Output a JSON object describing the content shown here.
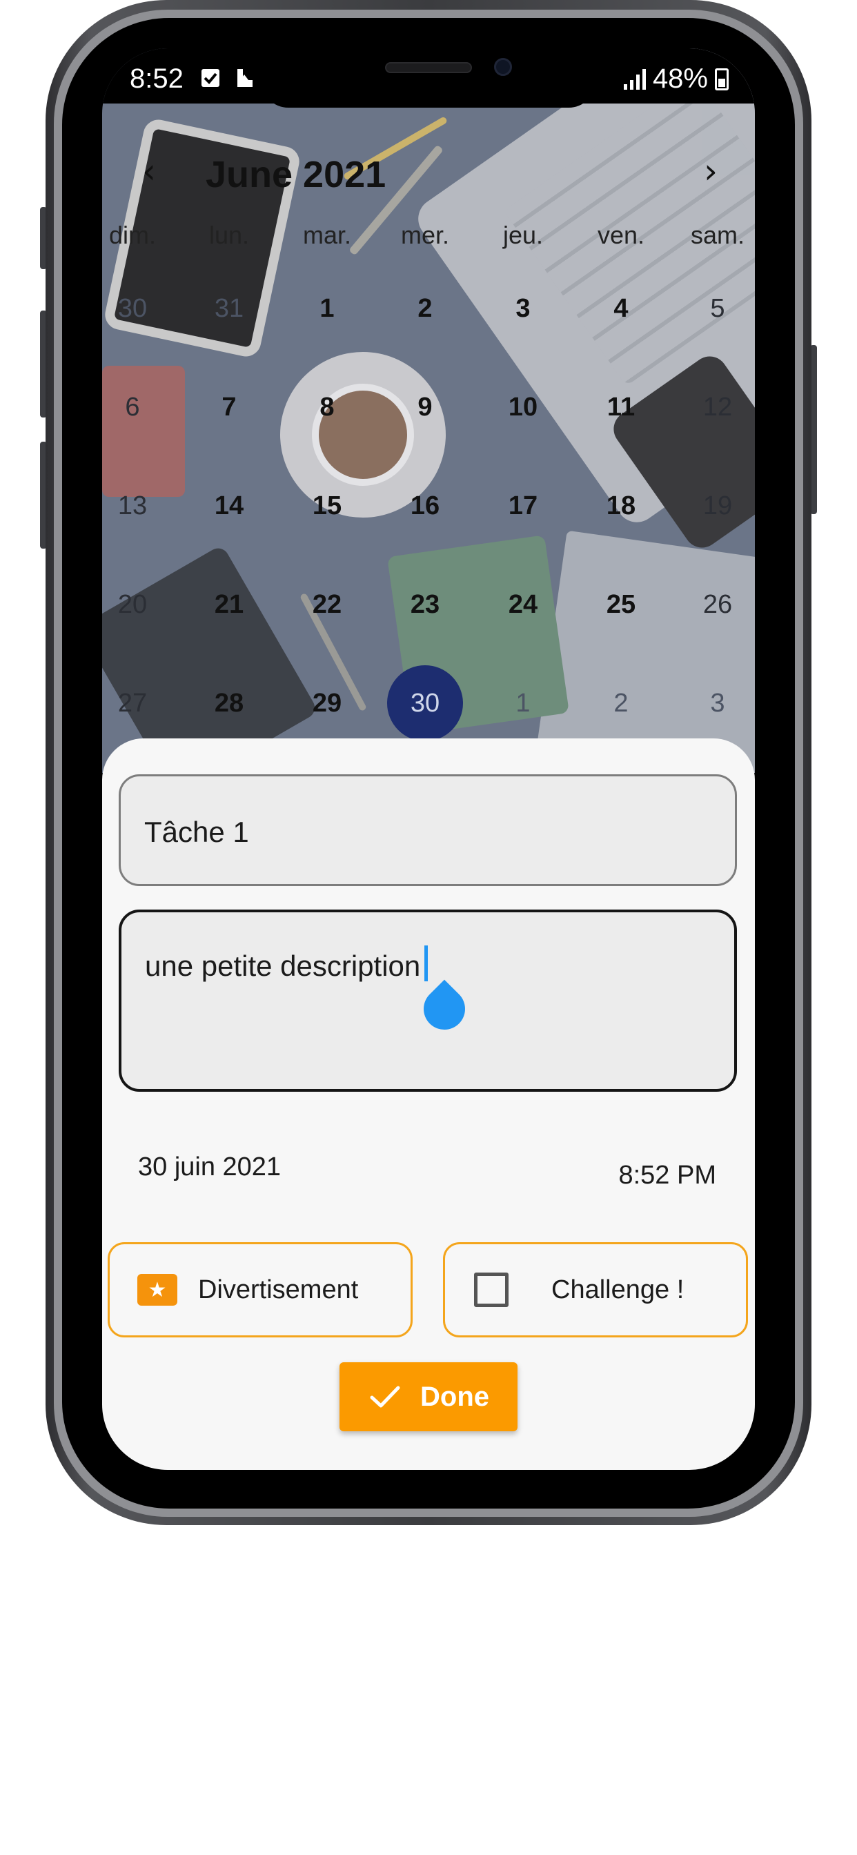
{
  "status_bar": {
    "time": "8:52",
    "battery": "48%",
    "icons": [
      "checkbox-notification-icon",
      "image-notification-icon",
      "signal-icon",
      "battery-charging-icon"
    ]
  },
  "calendar": {
    "title": "June 2021",
    "prev_icon": "chevron-left-icon",
    "next_icon": "chevron-right-icon",
    "weekdays": [
      "dim.",
      "lun.",
      "mar.",
      "mer.",
      "jeu.",
      "ven.",
      "sam."
    ],
    "weeks": [
      [
        "30",
        "31",
        "1",
        "2",
        "3",
        "4",
        "5"
      ],
      [
        "6",
        "7",
        "8",
        "9",
        "10",
        "11",
        "12"
      ],
      [
        "13",
        "14",
        "15",
        "16",
        "17",
        "18",
        "19"
      ],
      [
        "20",
        "21",
        "22",
        "23",
        "24",
        "25",
        "26"
      ],
      [
        "27",
        "28",
        "29",
        "30",
        "1",
        "2",
        "3"
      ]
    ],
    "selected_day": "30"
  },
  "form": {
    "title_value": "Tâche 1",
    "description_value": "une petite description",
    "date": "30 juin 2021",
    "time": "8:52 PM",
    "category_label": "Divertisement",
    "category_icon": "ticket-star-icon",
    "challenge_label": "Challenge !",
    "challenge_checked": false,
    "done_label": "Done",
    "done_icon": "check-icon"
  },
  "colors": {
    "accent_orange": "#fb9a00",
    "chip_border": "#f4a51c",
    "selected_day_bg": "#1d2d70",
    "cursor_blue": "#2196f3"
  }
}
